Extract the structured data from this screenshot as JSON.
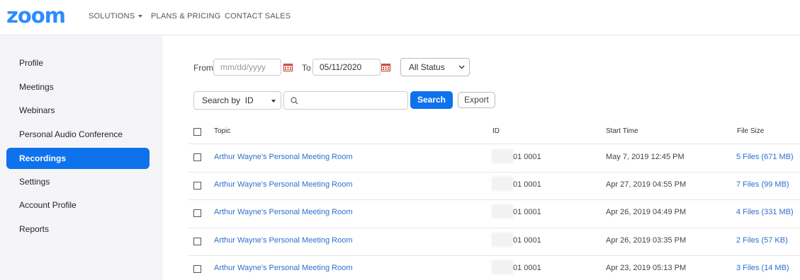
{
  "header": {
    "logo": "zoom",
    "nav": [
      {
        "label": "SOLUTIONS",
        "has_caret": true
      },
      {
        "label": "PLANS & PRICING",
        "has_caret": false
      },
      {
        "label": "CONTACT SALES",
        "has_caret": false
      }
    ]
  },
  "sidebar": {
    "items": [
      {
        "label": "Profile",
        "active": false
      },
      {
        "label": "Meetings",
        "active": false
      },
      {
        "label": "Webinars",
        "active": false
      },
      {
        "label": "Personal Audio Conference",
        "active": false
      },
      {
        "label": "Recordings",
        "active": true
      },
      {
        "label": "Settings",
        "active": false
      },
      {
        "label": "Account Profile",
        "active": false
      },
      {
        "label": "Reports",
        "active": false
      }
    ]
  },
  "filters": {
    "from_label": "From",
    "from_placeholder": "mm/dd/yyyy",
    "to_label": "To",
    "to_value": "05/11/2020",
    "status_value": "All Status",
    "search_by_value": "Search by  ID",
    "search_input_value": "",
    "search_button": "Search",
    "export_button": "Export"
  },
  "table": {
    "columns": [
      "Topic",
      "ID",
      "Start Time",
      "File Size"
    ],
    "rows": [
      {
        "topic": "Arthur Wayne's Personal Meeting Room",
        "id": "01 0001",
        "start": "May 7, 2019 12:45 PM",
        "size": "5 Files (671 MB)"
      },
      {
        "topic": "Arthur Wayne's Personal Meeting Room",
        "id": "01 0001",
        "start": "Apr 27, 2019 04:55 PM",
        "size": "7 Files (99 MB)"
      },
      {
        "topic": "Arthur Wayne's Personal Meeting Room",
        "id": "01 0001",
        "start": "Apr 26, 2019 04:49 PM",
        "size": "4 Files (331 MB)"
      },
      {
        "topic": "Arthur Wayne's Personal Meeting Room",
        "id": "01 0001",
        "start": "Apr 26, 2019 03:35 PM",
        "size": "2 Files (57 KB)"
      },
      {
        "topic": "Arthur Wayne's Personal Meeting Room",
        "id": "01 0001",
        "start": "Apr 23, 2019 05:13 PM",
        "size": "3 Files (14 MB)"
      }
    ]
  },
  "colors": {
    "brand": "#2d8cff",
    "accent": "#0e72ed",
    "link": "#2d6fce"
  }
}
